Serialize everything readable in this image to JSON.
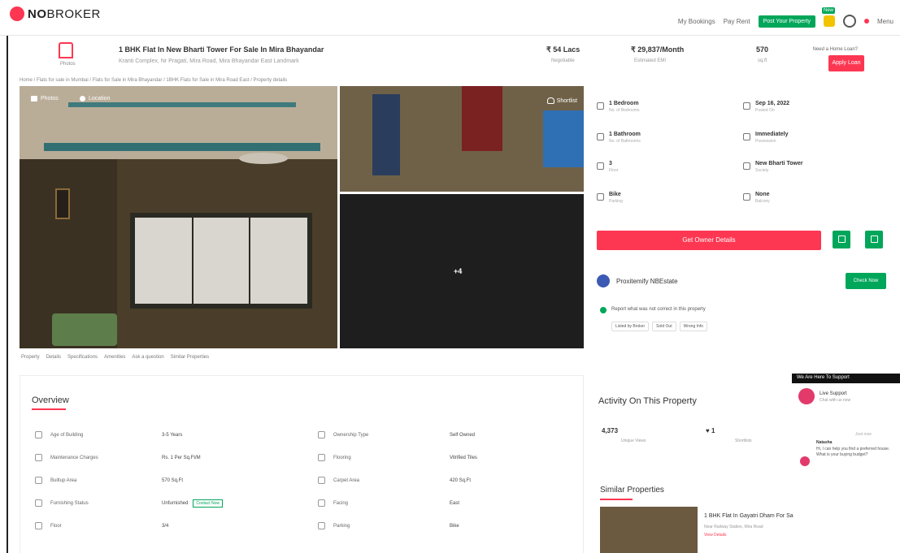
{
  "brand": {
    "logo_bold": "NO",
    "logo_rest": "BROKER",
    "accent": "#fd3752",
    "green": "#00a65a"
  },
  "nav": {
    "bookings": "My Bookings",
    "plans": "Pay Rent",
    "post_property": "Post Your Property",
    "new_badge": "New",
    "menu": "Menu"
  },
  "property": {
    "home_label": "Photos",
    "title": "1 BHK Flat In New Bharti Tower For Sale In Mira Bhayandar",
    "address": "Kranti Complex, Nr Pragati, Mira Road, Mira Bhayandar East Landmark",
    "price": "₹ 54 Lacs",
    "price_sub": "Negotiable",
    "emi": "₹ 29,837/Month",
    "emi_sub": "Estimated EMI",
    "area": "570",
    "area_sub": "sq.ft",
    "notify_caption": "Need a Home Loan?",
    "notify_button": "Apply Loan"
  },
  "breadcrumb": "Home / Flats for sale in Mumbai / Flats for Sale in Mira Bhayandar / 1BHK Flats for Sale in Mira Road East / Property details",
  "gallery": {
    "photos_tab": "Photos",
    "location_tab": "Location",
    "shortlist": "Shortlist",
    "more_count": "+4"
  },
  "section_tabs": [
    "Property",
    "Details",
    "Specifications",
    "Amenities",
    "Ask a question",
    "Similar Properties"
  ],
  "overview": {
    "title": "Overview",
    "rows": [
      {
        "label": "Age of Building",
        "value": "3-5 Years",
        "label2": "Ownership Type",
        "value2": "Self Owned"
      },
      {
        "label": "Maintenance Charges",
        "value": "Rs. 1 Per Sq.Ft/M",
        "label2": "Flooring",
        "value2": "Vitrified Tiles"
      },
      {
        "label": "Builtup Area",
        "value": "570 Sq.Ft",
        "label2": "Carpet Area",
        "value2": "420 Sq.Ft"
      },
      {
        "label": "Furnishing Status",
        "value": "Unfurnished",
        "value_link": "Contact Now",
        "label2": "Facing",
        "value2": "East"
      },
      {
        "label": "Floor",
        "value": "3/4",
        "label2": "Parking",
        "value2": "Bike"
      }
    ]
  },
  "details": [
    {
      "label": "1 Bedroom",
      "sub": "No. of Bedrooms"
    },
    {
      "label": "Sep 16, 2022",
      "sub": "Posted On"
    },
    {
      "label": "1 Bathroom",
      "sub": "No. of Bathrooms"
    },
    {
      "label": "Immediately",
      "sub": "Possession"
    },
    {
      "label": "3",
      "sub": "Floor"
    },
    {
      "label": "New Bharti Tower",
      "sub": "Society"
    },
    {
      "label": "Bike",
      "sub": "Parking"
    },
    {
      "label": "None",
      "sub": "Balcony"
    }
  ],
  "owner_button": "Get Owner Details",
  "promo": {
    "text": "Proxitemify NBEstate",
    "button": "Check Now",
    "report": "Report what was not correct in this property",
    "chips": [
      "Listed by Broker",
      "Sold Out",
      "Wrong Info"
    ]
  },
  "activity": {
    "title": "Activity On This Property",
    "views": "4,373",
    "views_label": "Unique Views",
    "shortlists": "1",
    "shortlists_label": "Shortlists"
  },
  "similar": {
    "title": "Similar Properties",
    "item_title": "1 BHK Flat In Gayatri Dham For Sa",
    "item_sub": "Near Railway Station, Mira Road",
    "item_link": "View Details"
  },
  "chat": {
    "header": "We Are Here To Support",
    "name": "Live Support",
    "sub": "Chat with us now",
    "time": "Just now",
    "agent": "Natasha",
    "message": "Hi, I can help you find a preferred house. What is your buying budget?"
  }
}
